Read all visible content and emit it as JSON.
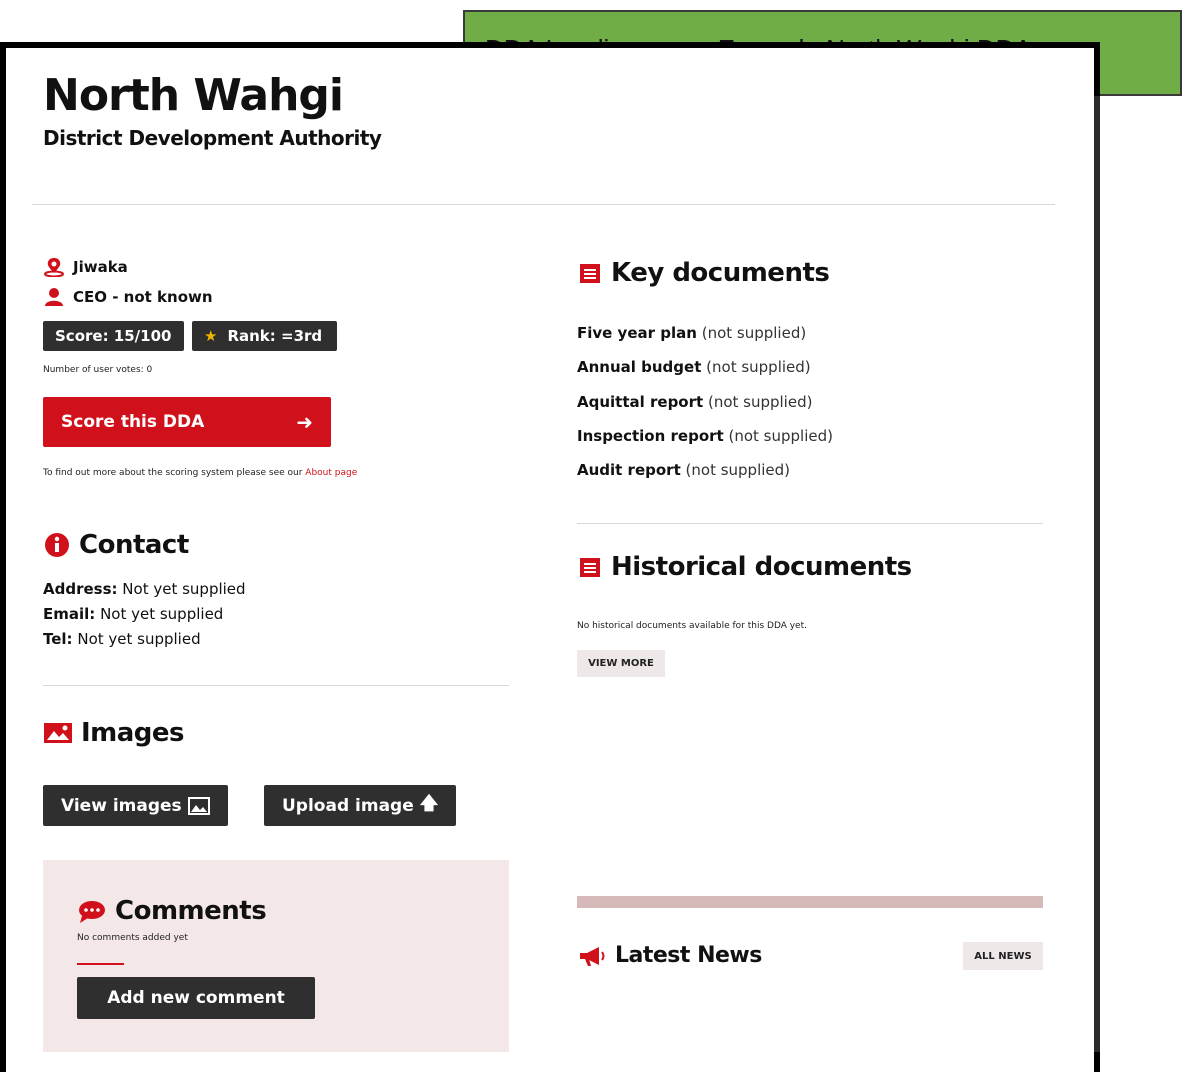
{
  "annotation": "DDA Landing page. Example North Waghi DDA",
  "header": {
    "title": "North Wahgi",
    "subtitle": "District Development Authority"
  },
  "profile": {
    "province": "Jiwaka",
    "ceo": "CEO - not known",
    "score": "Score: 15/100",
    "rank": "Rank: =3rd",
    "votes_label": "Number of user votes: 0",
    "score_button": "Score this DDA",
    "about_text": "To find out more about the scoring system please see our ",
    "about_link": "About page"
  },
  "contact": {
    "heading": "Contact",
    "rows": [
      {
        "label": "Address:",
        "value": "Not yet supplied"
      },
      {
        "label": "Email:",
        "value": "Not yet supplied"
      },
      {
        "label": "Tel:",
        "value": "Not yet supplied"
      }
    ]
  },
  "images": {
    "heading": "Images",
    "view_button": "View images",
    "upload_button": "Upload image"
  },
  "comments": {
    "heading": "Comments",
    "empty_text": "No comments added yet",
    "add_button": "Add new comment"
  },
  "key_documents": {
    "heading": "Key documents",
    "items": [
      {
        "name": "Five year plan",
        "status": "(not supplied)"
      },
      {
        "name": "Annual budget",
        "status": "(not supplied)"
      },
      {
        "name": "Aquittal report",
        "status": "(not supplied)"
      },
      {
        "name": "Inspection report",
        "status": "(not supplied)"
      },
      {
        "name": "Audit report",
        "status": "(not supplied)"
      }
    ]
  },
  "historical_documents": {
    "heading": "Historical documents",
    "empty_text": "No historical documents available for this DDA yet.",
    "view_more": "VIEW MORE"
  },
  "news": {
    "heading": "Latest News",
    "all_news": "ALL NEWS"
  },
  "colors": {
    "accent": "#d0111b",
    "dark": "#2f2f2f",
    "note_green": "#70ad47",
    "panel": "#f3e8e7"
  }
}
